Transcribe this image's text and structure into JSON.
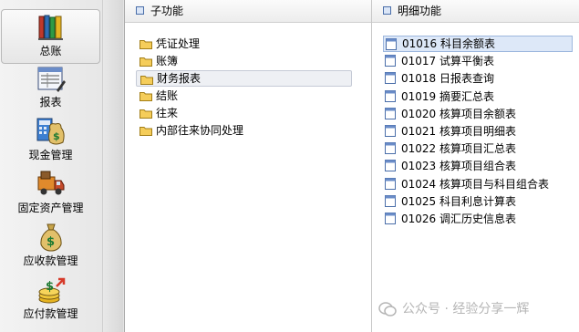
{
  "nav": {
    "items": [
      {
        "label": "总账",
        "icon": "books-icon"
      },
      {
        "label": "报表",
        "icon": "report-icon"
      },
      {
        "label": "现金管理",
        "icon": "cash-bag-calculator-icon"
      },
      {
        "label": "固定资产管理",
        "icon": "truck-asset-icon"
      },
      {
        "label": "应收款管理",
        "icon": "money-bag-icon"
      },
      {
        "label": "应付款管理",
        "icon": "coins-payable-icon"
      }
    ]
  },
  "sub_panel": {
    "title": "子功能",
    "items": [
      "凭证处理",
      "账簿",
      "财务报表",
      "结账",
      "往来",
      "内部往来协同处理"
    ],
    "selected_index": 2
  },
  "detail_panel": {
    "title": "明细功能",
    "items": [
      {
        "code": "01016",
        "name": "科目余额表"
      },
      {
        "code": "01017",
        "name": "试算平衡表"
      },
      {
        "code": "01018",
        "name": "日报表查询"
      },
      {
        "code": "01019",
        "name": "摘要汇总表"
      },
      {
        "code": "01020",
        "name": "核算项目余额表"
      },
      {
        "code": "01021",
        "name": "核算项目明细表"
      },
      {
        "code": "01022",
        "name": "核算项目汇总表"
      },
      {
        "code": "01023",
        "name": "核算项目组合表"
      },
      {
        "code": "01024",
        "name": "核算项目与科目组合表"
      },
      {
        "code": "01025",
        "name": "科目利息计算表"
      },
      {
        "code": "01026",
        "name": "调汇历史信息表"
      }
    ],
    "selected_index": 0
  },
  "watermark": {
    "text": "公众号 · 经验分享一辉"
  },
  "colors": {
    "header_square": "#4a6ea9",
    "selection": "#dde8f8",
    "folder": "#f5cd5a"
  }
}
